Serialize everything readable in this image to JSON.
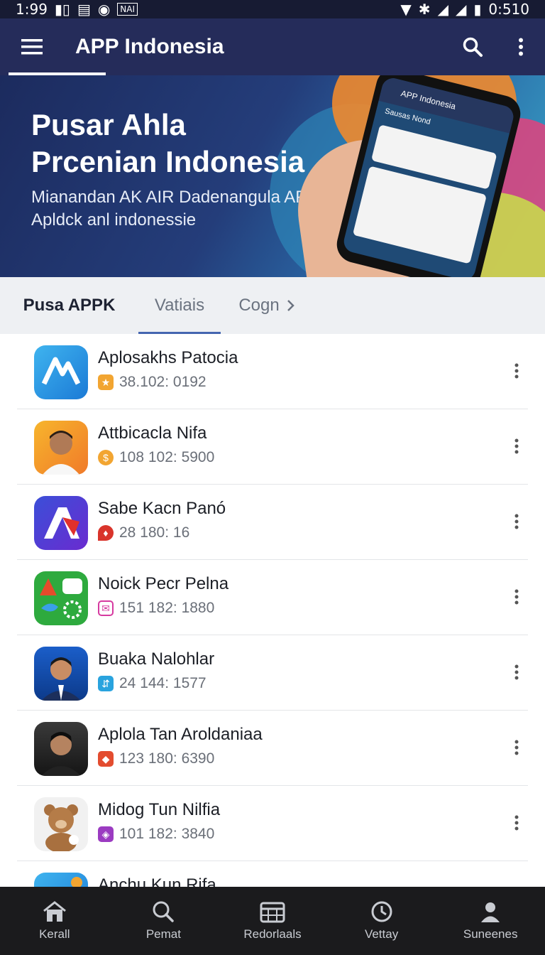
{
  "status_bar": {
    "time": "1:99",
    "left_badge": "NAI",
    "battery_time": "0:510"
  },
  "app_bar": {
    "title": "APP Indonesia",
    "icons": [
      "menu-icon",
      "search-icon",
      "more-vert-icon"
    ]
  },
  "hero": {
    "title_line1": "Pusar Ahla",
    "title_line2": "Prcenian  Indonesia",
    "subtitle_line1": "Mianandan AK AIR Dadenangula APK",
    "subtitle_line2": "Apldck anl indonessie",
    "phone_screen_title": "APP Indonesia",
    "phone_card_title": "Sausas Nond"
  },
  "tabs": [
    {
      "label": "Pusa APPK",
      "active": false
    },
    {
      "label": "Vatiais",
      "active": true
    },
    {
      "label": "Cogn",
      "active": false
    }
  ],
  "apps": [
    {
      "name": "Aplosakhs Patocia",
      "stats": "38.102: 0192",
      "badge_color": "#f2a531",
      "badge_glyph": "★",
      "icon": "blue-app-logo-icon"
    },
    {
      "name": "Attbicacla Nifa",
      "stats": "108 102: 5900",
      "badge_color": "#f2a531",
      "badge_glyph": "$",
      "icon": "man-portrait-icon"
    },
    {
      "name": "Sabe Kacn Panó",
      "stats": "28 180: 16",
      "badge_color": "#d9342b",
      "badge_glyph": "♦",
      "icon": "red-a-logo-icon"
    },
    {
      "name": "Noick Pecr Pelna",
      "stats": "151 182: 1880",
      "badge_color": "#d63aa0",
      "badge_glyph": "✉",
      "icon": "green-social-apps-icon"
    },
    {
      "name": "Buaka Nalohlar",
      "stats": "24 144: 1577",
      "badge_color": "#29a3de",
      "badge_glyph": "⇵",
      "icon": "man-suit-portrait-icon"
    },
    {
      "name": "Aplola Tan Aroldaniaa",
      "stats": "123 180: 6390",
      "badge_color": "#e34c2f",
      "badge_glyph": "◆",
      "icon": "smiling-man-portrait-icon"
    },
    {
      "name": "Midog Tun Nilfia",
      "stats": "101 182: 3840",
      "badge_color": "#9b3bc1",
      "badge_glyph": "◈",
      "icon": "teddy-bear-icon"
    },
    {
      "name": "Anchu Kun Rifa",
      "stats": "",
      "badge_color": "#29a3de",
      "badge_glyph": "",
      "icon": "blue-app-partial-icon"
    }
  ],
  "bottom_nav": [
    {
      "label": "Kerall",
      "icon": "home-icon"
    },
    {
      "label": "Pemat",
      "icon": "search-icon"
    },
    {
      "label": "Redorlaals",
      "icon": "calendar-grid-icon"
    },
    {
      "label": "Vettay",
      "icon": "clock-icon"
    },
    {
      "label": "Suneenes",
      "icon": "person-icon"
    }
  ]
}
